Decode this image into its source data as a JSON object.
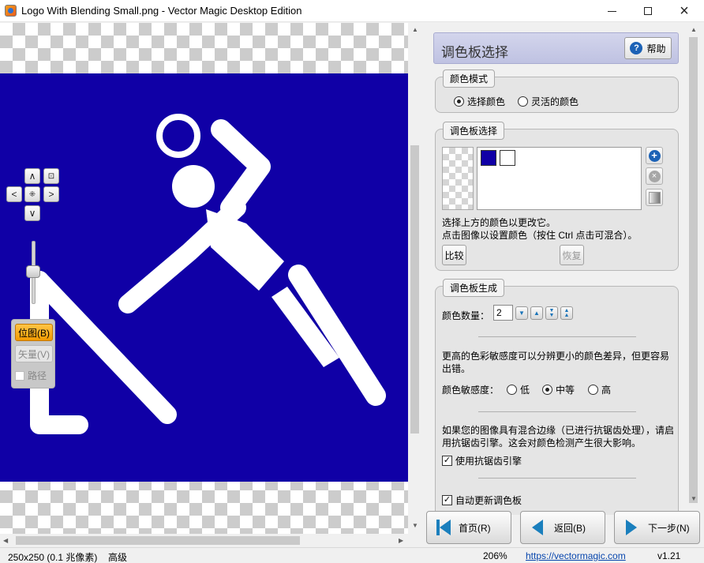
{
  "window": {
    "title": "Logo With Blending Small.png - Vector Magic Desktop Edition",
    "minimize": "minimize",
    "maximize": "maximize",
    "close": "×"
  },
  "nav": {
    "up": "∧",
    "down": "∨",
    "left": "<",
    "right": ">",
    "center": "⁜",
    "fit": "⊡"
  },
  "view_modes": {
    "bitmap": "位图(B)",
    "vector": "矢量(V)",
    "path": "路径"
  },
  "panel": {
    "title": "调色板选择",
    "help": "帮助"
  },
  "color_mode": {
    "label": "颜色模式",
    "option_selected": "选择颜色",
    "option_flexible": "灵活的颜色",
    "selected": "选择颜色"
  },
  "palette_select": {
    "label": "调色板选择",
    "colors": [
      "#1000a6",
      "#ffffff"
    ],
    "hint1": "选择上方的颜色以更改它。",
    "hint2": "点击图像以设置颜色（按住 Ctrl 点击可混合）。",
    "compare": "比较",
    "restore": "恢复"
  },
  "palette_gen": {
    "label": "调色板生成",
    "count_label": "颜色数量：",
    "count_value": "2",
    "sensitivity_desc": "更高的色彩敏感度可以分辨更小的颜色差异，但更容易出错。",
    "sensitivity_label": "颜色敏感度：",
    "low": "低",
    "medium": "中等",
    "high": "高",
    "sensitivity_selected": "中等",
    "aa_desc": "如果您的图像具有混合边缘（已进行抗锯齿处理），请启用抗锯齿引擎。这会对颜色检测产生很大影响。",
    "aa_checkbox": "使用抗锯齿引擎",
    "aa_checked": true,
    "auto_update": "自动更新调色板",
    "auto_checked": true
  },
  "bottom_nav": {
    "home": "首页(R)",
    "back": "返回(B)",
    "next": "下一步(N)"
  },
  "status": {
    "size": "250x250 (0.1 兆像素)",
    "quality": "高级",
    "zoom": "206%",
    "link": "https://vectormagic.com",
    "version": "v1.21"
  }
}
